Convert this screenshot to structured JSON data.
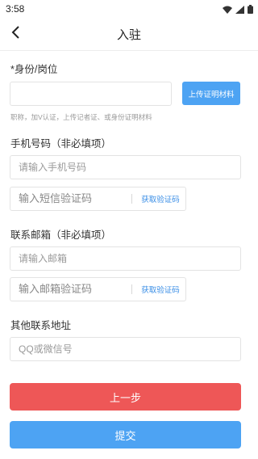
{
  "status_bar": {
    "time": "3:58",
    "icons": [
      "wifi-icon",
      "signal-icon",
      "battery-icon"
    ]
  },
  "header": {
    "title": "入驻",
    "back_icon": "chevron-left-icon"
  },
  "identity": {
    "label": "*身份/岗位",
    "input_value": "",
    "upload_label": "上传证明材料",
    "hint": "职称，加V认证，上传记者证、或身份证明材料"
  },
  "phone": {
    "label": "手机号码（非必填项）",
    "placeholder": "请输入手机号码",
    "code_placeholder": "输入短信验证码",
    "get_code_label": "获取验证码"
  },
  "email": {
    "label": "联系邮箱（非必填项）",
    "placeholder": "请输入邮箱",
    "code_placeholder": "输入邮箱验证码",
    "get_code_label": "获取验证码"
  },
  "other": {
    "label": "其他联系地址",
    "placeholder": "QQ或微信号"
  },
  "actions": {
    "prev_label": "上一步",
    "submit_label": "提交"
  },
  "colors": {
    "accent_blue": "#4da3f3",
    "link_blue": "#3a8ee6",
    "prev_red": "#ee5757"
  }
}
